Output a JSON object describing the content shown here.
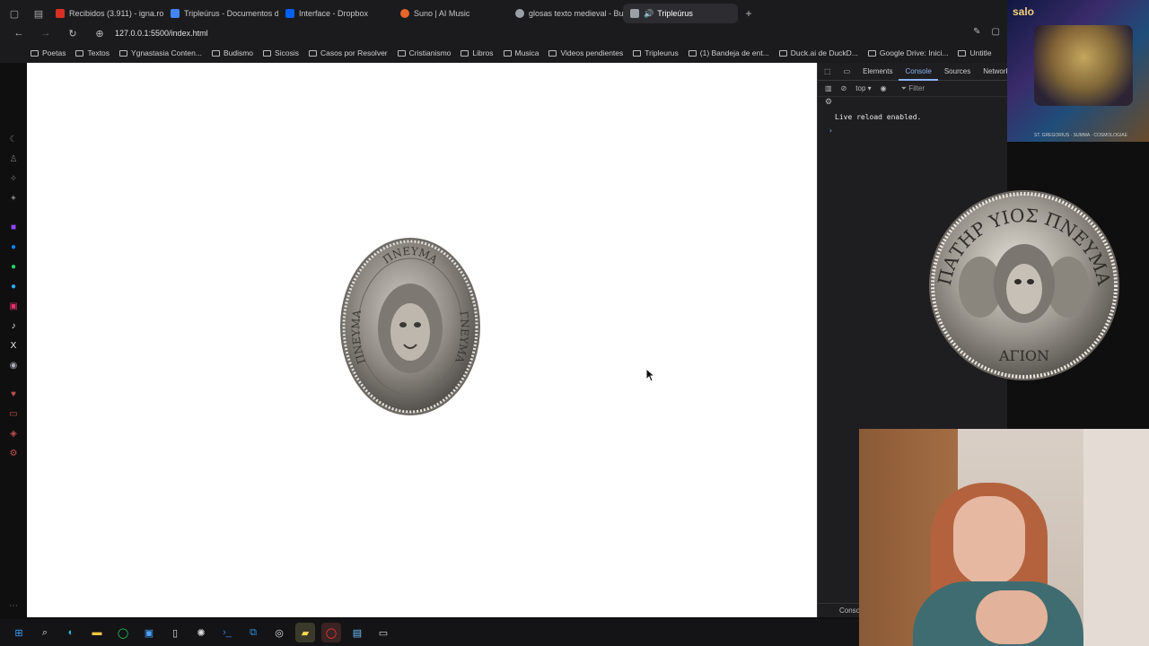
{
  "tabs": [
    {
      "label": "Recibidos (3.911) - igna.ro",
      "color": "#d93025"
    },
    {
      "label": "Tripleúrus - Documentos d",
      "color": "#4285f4"
    },
    {
      "label": "Interface - Dropbox",
      "color": "#0061ff"
    },
    {
      "label": "Suno | AI Music",
      "color": "#e8652b"
    },
    {
      "label": "glosas texto medieval - Bu",
      "color": "#9aa0a6"
    },
    {
      "label": "Tripleúrus",
      "color": "#9aa0a6",
      "active": true
    }
  ],
  "address": {
    "url": "127.0.0.1:5500/index.html"
  },
  "bookmarks": [
    "Poetas",
    "Textos",
    "Ygnastasia Conten...",
    "Budismo",
    "Sicosis",
    "Casos por Resolver",
    "Cristianismo",
    "Libros",
    "Musica",
    "Videos pendientes",
    "Tripleurus",
    "(1) Bandeja de ent...",
    "Duck.ai de DuckD...",
    "Google Drive: Inici...",
    "Untitle"
  ],
  "page": {
    "coin_front": {
      "top": "ΠΝΕΥΜΑ",
      "left": "ΠΝΕΥΜΑ",
      "right": "ΓΝΕΥΜΑ"
    }
  },
  "devtools": {
    "tabs": [
      "Elements",
      "Console",
      "Sources",
      "Network"
    ],
    "active_tab": "Console",
    "context": "top",
    "filter_placeholder": "Filter",
    "message": "Live reload enabled.",
    "prompt": "›",
    "bottom": "Conso"
  },
  "overlay": {
    "label": "salo",
    "caption": "ST. GREGORIUS · SUMMA · COSMOLOGIAE",
    "coin_big": {
      "top": "ΠΑΤΗΡ ΥΙΟΣ ΠΝΕΥΜΑ",
      "bottom": "ΑΓΙΟΝ"
    }
  },
  "colors": {
    "accent": "#8ab4f8",
    "chrome": "#1b1b1d"
  }
}
